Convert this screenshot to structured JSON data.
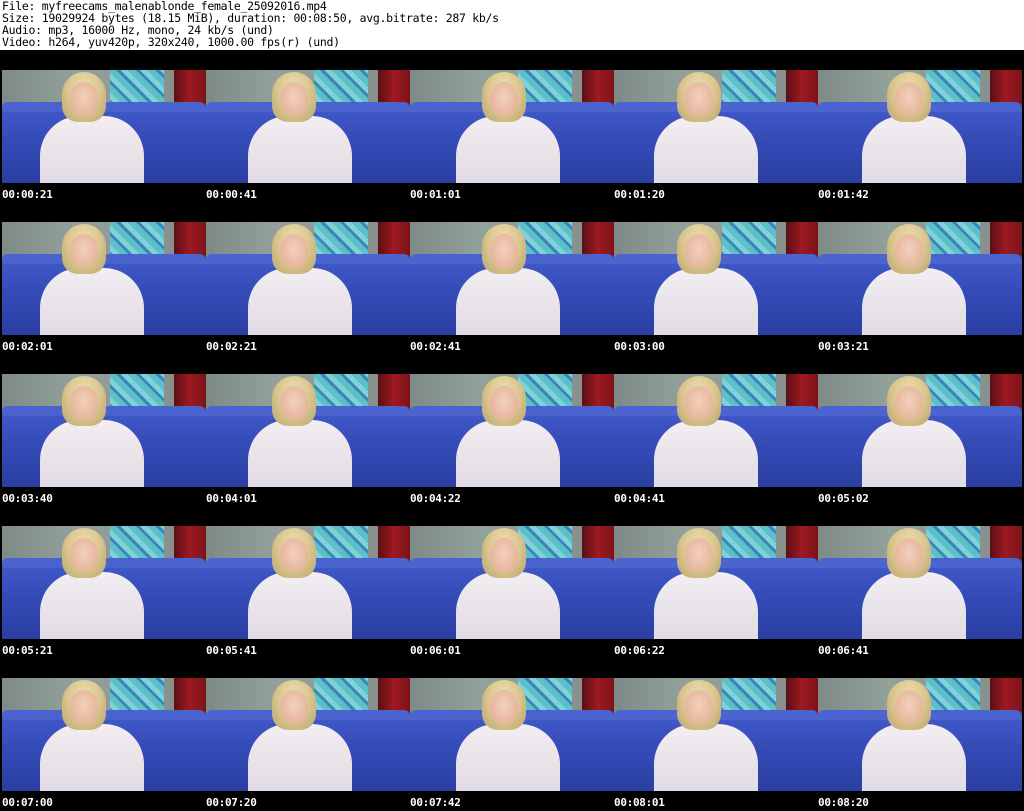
{
  "header": {
    "line1": "File: myfreecams_malenablonde_female_25092016.mp4",
    "line2": "Size: 19029924 bytes (18.15 MiB), duration: 00:08:50, avg.bitrate: 287 kb/s",
    "line3": "Audio: mp3, 16000 Hz, mono, 24 kb/s (und)",
    "line4": "Video: h264, yuv420p, 320x240, 1000.00 fps(r) (und)"
  },
  "thumbnails": [
    {
      "timestamp": "00:00:21"
    },
    {
      "timestamp": "00:00:41"
    },
    {
      "timestamp": "00:01:01"
    },
    {
      "timestamp": "00:01:20"
    },
    {
      "timestamp": "00:01:42"
    },
    {
      "timestamp": "00:02:01"
    },
    {
      "timestamp": "00:02:21"
    },
    {
      "timestamp": "00:02:41"
    },
    {
      "timestamp": "00:03:00"
    },
    {
      "timestamp": "00:03:21"
    },
    {
      "timestamp": "00:03:40"
    },
    {
      "timestamp": "00:04:01"
    },
    {
      "timestamp": "00:04:22"
    },
    {
      "timestamp": "00:04:41"
    },
    {
      "timestamp": "00:05:02"
    },
    {
      "timestamp": "00:05:21"
    },
    {
      "timestamp": "00:05:41"
    },
    {
      "timestamp": "00:06:01"
    },
    {
      "timestamp": "00:06:22"
    },
    {
      "timestamp": "00:06:41"
    },
    {
      "timestamp": "00:07:00"
    },
    {
      "timestamp": "00:07:20"
    },
    {
      "timestamp": "00:07:42"
    },
    {
      "timestamp": "00:08:01"
    },
    {
      "timestamp": "00:08:20"
    }
  ]
}
